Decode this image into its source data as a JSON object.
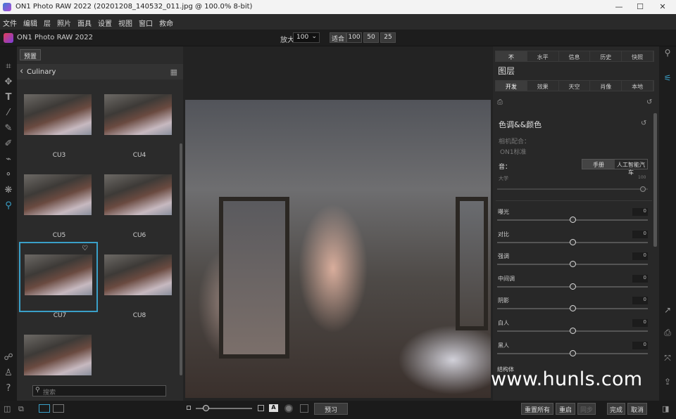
{
  "window": {
    "title": "ON1 Photo RAW 2022 (20201208_140532_011.jpg @ 100.0% 8-bit)",
    "controls": [
      "—",
      "☐",
      "✕"
    ]
  },
  "menu": [
    "文件",
    "编辑",
    "层",
    "照片",
    "面具",
    "设置",
    "视图",
    "窗口",
    "救命"
  ],
  "appbar": {
    "app_name": "ON1 Photo RAW 2022",
    "zoom_label": "放大",
    "zoom_value": "100",
    "zoom_buttons": [
      "适合",
      "100",
      "50",
      "25"
    ]
  },
  "browser": {
    "preset_button": "预置",
    "folder": "Culinary",
    "thumbnails": [
      {
        "label": "CU3"
      },
      {
        "label": "CU4"
      },
      {
        "label": "CU5"
      },
      {
        "label": "CU6"
      },
      {
        "label": "CU7",
        "selected": true,
        "favorite": true
      },
      {
        "label": "CU8"
      },
      {
        "label": ""
      }
    ],
    "search_placeholder": "搜索"
  },
  "right_panel": {
    "top_tabs": [
      "不",
      "水平",
      "信息",
      "历史",
      "快照"
    ],
    "layers_title": "图层",
    "module_tabs": [
      "开发",
      "效果",
      "天空",
      "肖像",
      "本地"
    ],
    "section_title": "色调&&颜色",
    "camera_match_label": "相机配合：",
    "camera_match_value": "ON1标准",
    "tone_label": "音：",
    "tone_modes": [
      "手册",
      "人工智能汽车"
    ],
    "amount_label": "大学",
    "amount_value": "100",
    "sliders": [
      {
        "name": "曝光",
        "value": "0",
        "fraction": 0.5
      },
      {
        "name": "对比",
        "value": "0",
        "fraction": 0.5
      },
      {
        "name": "强调",
        "value": "0",
        "fraction": 0.5
      },
      {
        "name": "中间调",
        "value": "0",
        "fraction": 0.5
      },
      {
        "name": "阴影",
        "value": "0",
        "fraction": 0.5
      },
      {
        "name": "白人",
        "value": "0",
        "fraction": 0.5
      },
      {
        "name": "黑人",
        "value": "0",
        "fraction": 0.5
      }
    ],
    "next_label": "结构体",
    "next_value": "0"
  },
  "statusbar": {
    "preview_button": "预习",
    "buttons": [
      "重置所有",
      "重启",
      "同步",
      "完成",
      "取消"
    ]
  },
  "watermark": "www.hunls.com"
}
